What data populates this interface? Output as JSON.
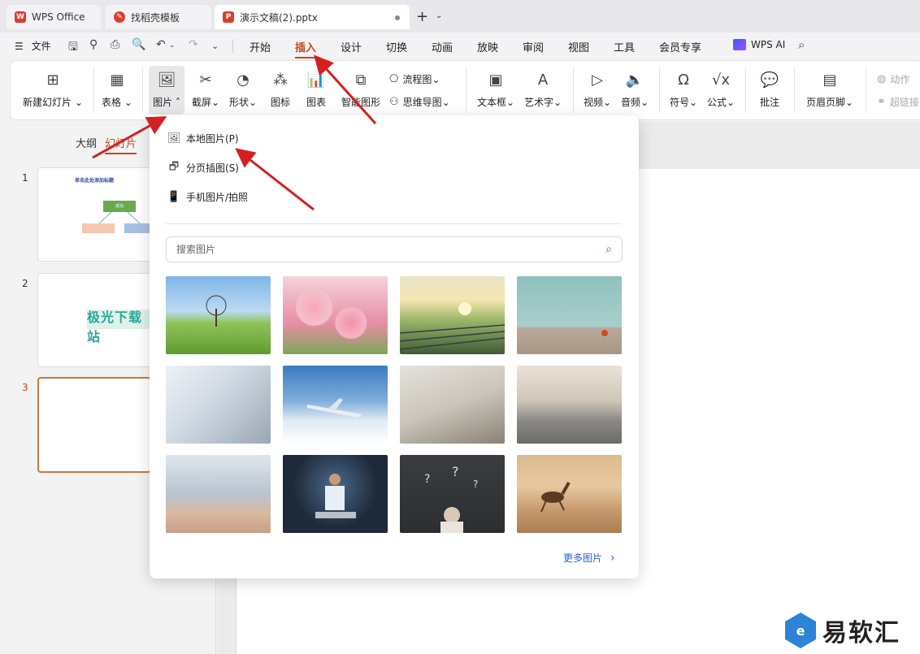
{
  "tabs": [
    {
      "label": "WPS Office",
      "icon": "wps-logo-icon"
    },
    {
      "label": "找稻壳模板",
      "icon": "docer-icon"
    },
    {
      "label": "演示文稿(2).pptx",
      "icon": "ppt-file-icon"
    }
  ],
  "menu": {
    "file": "文件",
    "items": [
      "开始",
      "插入",
      "设计",
      "切换",
      "动画",
      "放映",
      "审阅",
      "视图",
      "工具",
      "会员专享"
    ],
    "active": "插入",
    "ai": "WPS AI"
  },
  "ribbon": {
    "new_slide": "新建幻灯片",
    "table": "表格",
    "picture": "图片",
    "screenshot": "截屏",
    "shape": "形状",
    "icon": "图标",
    "chart": "图表",
    "smartart": "智能图形",
    "flowchart": "流程图",
    "mindmap": "思维导图",
    "textbox": "文本框",
    "wordart": "艺术字",
    "video": "视频",
    "audio": "音频",
    "symbol": "符号",
    "formula": "公式",
    "comment": "批注",
    "header_footer": "页眉页脚",
    "action": "动作",
    "hyperlink": "超链接"
  },
  "left_panel": {
    "tab_outline": "大纲",
    "tab_slides": "幻灯片",
    "slides": [
      {
        "num": "1",
        "title": "单击此处添加标题",
        "box": "成功"
      },
      {
        "num": "2",
        "text": "极光下载站"
      },
      {
        "num": "3"
      }
    ]
  },
  "dropdown": {
    "items": [
      {
        "label": "本地图片(P)",
        "icon": "image-icon"
      },
      {
        "label": "分页插图(S)",
        "icon": "paged-image-icon"
      },
      {
        "label": "手机图片/拍照",
        "icon": "phone-image-icon"
      }
    ],
    "search_placeholder": "搜索图片",
    "thumbnails": [
      "tree-on-meadow-photo",
      "pink-tulips-photo",
      "solar-farm-sunset-photo",
      "teal-wall-apple-photo",
      "hands-phone-photo",
      "airplane-sky-photo",
      "business-document-photo",
      "gym-treadmills-photo",
      "hands-raised-team-photo",
      "businessman-celebrating-photo",
      "chalkboard-question-marks-photo",
      "running-horse-photo"
    ],
    "more": "更多图片"
  },
  "watermark": {
    "text": "易软汇"
  },
  "colors": {
    "accent": "#c8491b",
    "link": "#2a63d6",
    "arrow": "#d42020"
  }
}
